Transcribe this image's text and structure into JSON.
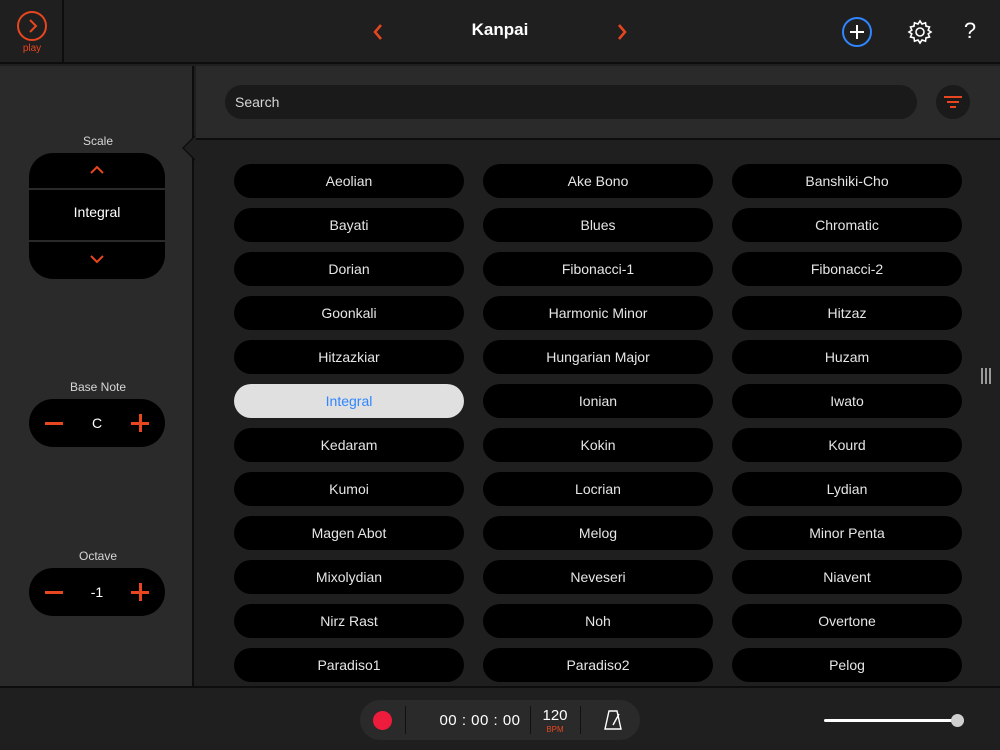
{
  "header": {
    "play_label": "play",
    "title": "Kanpai",
    "help_label": "?"
  },
  "colors": {
    "accent": "#e8461e",
    "add_button": "#2f86ff",
    "selected_text": "#2f86ff",
    "record": "#ee1c3c"
  },
  "icons": [
    "play-icon",
    "prev-arrow-icon",
    "next-arrow-icon",
    "add-icon",
    "gear-icon",
    "help-icon",
    "filter-icon",
    "record-icon",
    "metronome-icon"
  ],
  "controls": {
    "scale": {
      "label": "Scale",
      "value": "Integral"
    },
    "base_note": {
      "label": "Base Note",
      "value": "C"
    },
    "octave": {
      "label": "Octave",
      "value": "-1"
    }
  },
  "search": {
    "placeholder": "Search"
  },
  "scales": {
    "selected": "Integral",
    "items": [
      "Aeolian",
      "Ake Bono",
      "Banshiki-Cho",
      "Bayati",
      "Blues",
      "Chromatic",
      "Dorian",
      "Fibonacci-1",
      "Fibonacci-2",
      "Goonkali",
      "Harmonic Minor",
      "Hitzaz",
      "Hitzazkiar",
      "Hungarian Major",
      "Huzam",
      "Integral",
      "Ionian",
      "Iwato",
      "Kedaram",
      "Kokin",
      "Kourd",
      "Kumoi",
      "Locrian",
      "Lydian",
      "Magen Abot",
      "Melog",
      "Minor Penta",
      "Mixolydian",
      "Neveseri",
      "Niavent",
      "Nirz Rast",
      "Noh",
      "Overtone",
      "Paradiso1",
      "Paradiso2",
      "Pelog"
    ]
  },
  "transport": {
    "time": "00 : 00 : 00",
    "bpm_value": "120",
    "bpm_label": "BPM",
    "volume_level": 0.95
  }
}
